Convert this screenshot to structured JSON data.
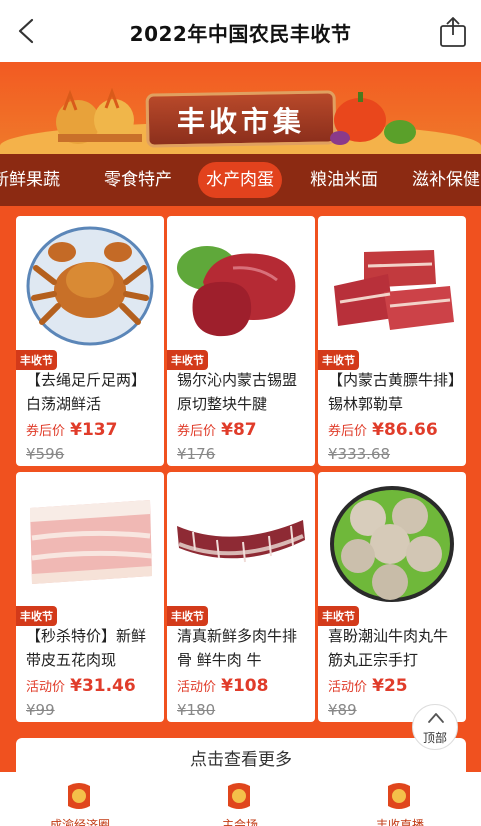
{
  "header": {
    "title": "2022年中国农民丰收节",
    "back_icon": "back-chevron-icon",
    "share_icon": "share-icon"
  },
  "banner": {
    "title": "丰收市集"
  },
  "categories": [
    {
      "label": "新鲜果蔬"
    },
    {
      "label": "零食特产"
    },
    {
      "label": "水产肉蛋",
      "active": true
    },
    {
      "label": "粮油米面"
    },
    {
      "label": "滋补保健"
    }
  ],
  "products": [
    {
      "tag": "丰收节",
      "name": "【去绳足斤足两】白荡湖鲜活",
      "price_label": "券后价",
      "price": "¥137",
      "original_price": "¥596"
    },
    {
      "tag": "丰收节",
      "name": "锡尔沁内蒙古锡盟原切整块牛腱",
      "price_label": "券后价",
      "price": "¥87",
      "original_price": "¥176"
    },
    {
      "tag": "丰收节",
      "name": "【内蒙古黄膘牛排】锡林郭勒草",
      "price_label": "券后价",
      "price": "¥86.66",
      "original_price": "¥333.68"
    },
    {
      "tag": "丰收节",
      "name": "【秒杀特价】新鲜带皮五花肉现",
      "price_label": "活动价",
      "price": "¥31.46",
      "original_price": "¥99"
    },
    {
      "tag": "丰收节",
      "name": "清真新鲜多肉牛排骨 鲜牛肉 牛",
      "price_label": "活动价",
      "price": "¥108",
      "original_price": "¥180"
    },
    {
      "tag": "丰收节",
      "name": "喜盼潮汕牛肉丸牛筋丸正宗手打",
      "price_label": "活动价",
      "price": "¥25",
      "original_price": "¥89"
    }
  ],
  "more": {
    "label": "点击查看更多"
  },
  "to_top": {
    "label": "顶部"
  },
  "bottom_nav": [
    {
      "label": "成渝经济圈",
      "icon": "festival-badge-icon"
    },
    {
      "label": "主会场",
      "icon": "festival-badge-icon"
    },
    {
      "label": "丰收直播",
      "icon": "festival-badge-icon"
    }
  ],
  "colors": {
    "accent": "#f0511f",
    "category_bar": "#8c2a12",
    "price": "#e03c2a",
    "tag": "#d33a1a"
  }
}
